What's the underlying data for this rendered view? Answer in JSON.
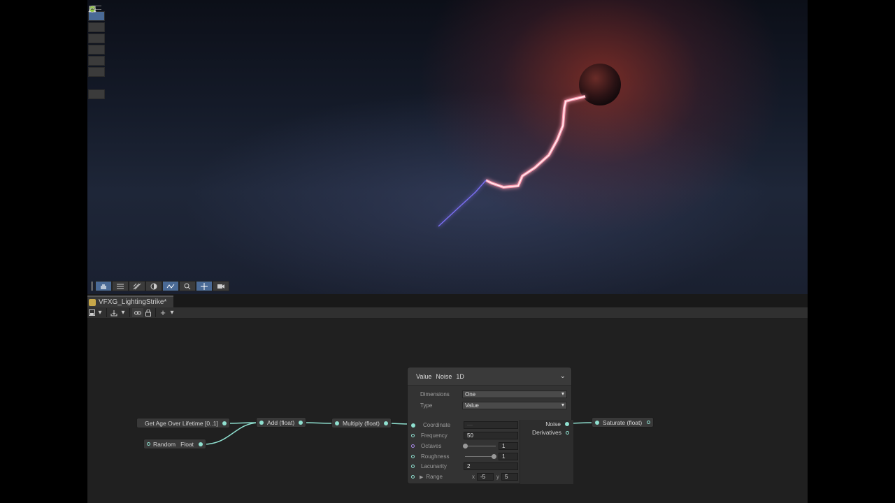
{
  "scene": {
    "tools": [
      "hand-icon",
      "move-icon",
      "rotate-icon",
      "scale-icon",
      "rect-icon",
      "transform-icon",
      "sphere-icon",
      "curve-icon"
    ],
    "bottom_tools": [
      "hand-icon",
      "layers-icon",
      "grid-icon",
      "shading-icon",
      "fx-icon",
      "zoom-icon",
      "gizmo-icon",
      "camera-icon"
    ]
  },
  "graph": {
    "tab_title": "VFXG_LightingStrike*",
    "nodes": {
      "age": "Get Age Over Lifetime [0..1]",
      "random": "Random",
      "random_type": "Float",
      "add": "Add (float)",
      "multiply": "Multiply (float)",
      "saturate": "Saturate (float)"
    },
    "noise": {
      "title_1": "Value",
      "title_2": "Noise",
      "title_3": "1D",
      "dimensions_label": "Dimensions",
      "dimensions_value": "One",
      "type_label": "Type",
      "type_value": "Value",
      "coordinate_label": "Coordinate",
      "coordinate_value": "—",
      "frequency_label": "Frequency",
      "frequency_value": "50",
      "octaves_label": "Octaves",
      "octaves_value": "1",
      "roughness_label": "Roughness",
      "roughness_value": "1",
      "lacunarity_label": "Lacunarity",
      "lacunarity_value": "2",
      "range_label": "Range",
      "range_x_label": "x",
      "range_x": "-5",
      "range_y_label": "y",
      "range_y": "5",
      "out_noise": "Noise",
      "out_derivatives": "Derivatives"
    }
  }
}
